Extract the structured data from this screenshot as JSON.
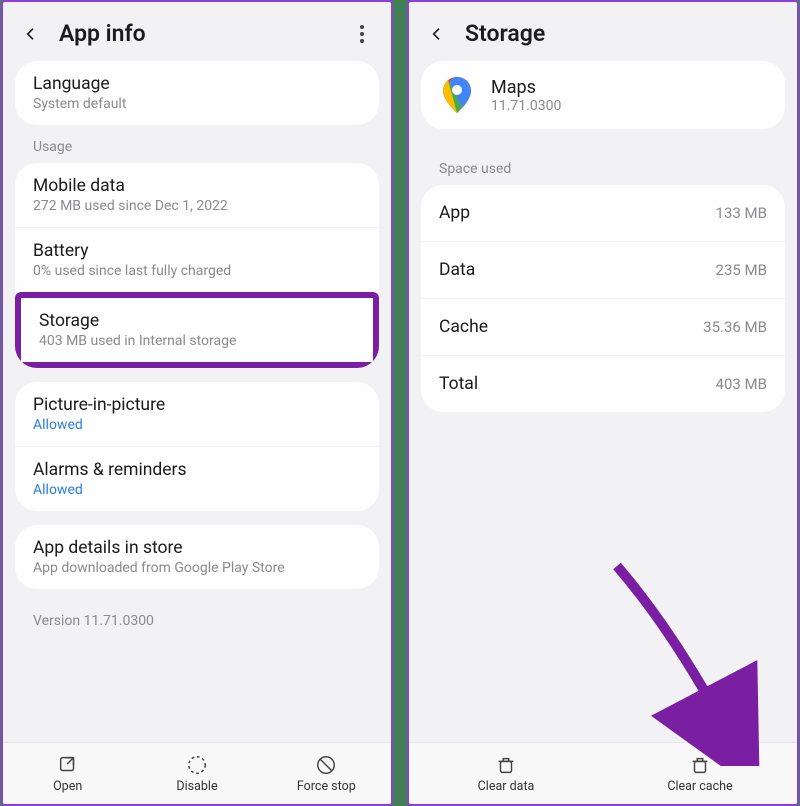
{
  "left": {
    "title": "App info",
    "language": {
      "label": "Language",
      "sub": "System default"
    },
    "section_usage": "Usage",
    "mobile_data": {
      "label": "Mobile data",
      "sub": "272 MB used since Dec 1, 2022"
    },
    "battery": {
      "label": "Battery",
      "sub": "0% used since last fully charged"
    },
    "storage": {
      "label": "Storage",
      "sub": "403 MB used in Internal storage"
    },
    "pip": {
      "label": "Picture-in-picture",
      "sub": "Allowed"
    },
    "alarms": {
      "label": "Alarms & reminders",
      "sub": "Allowed"
    },
    "details": {
      "label": "App details in store",
      "sub": "App downloaded from Google Play Store"
    },
    "version": "Version 11.71.0300",
    "btn_open": "Open",
    "btn_disable": "Disable",
    "btn_force": "Force stop"
  },
  "right": {
    "title": "Storage",
    "app_name": "Maps",
    "app_version": "11.71.0300",
    "section_space": "Space used",
    "rows": {
      "app": {
        "k": "App",
        "v": "133 MB"
      },
      "data": {
        "k": "Data",
        "v": "235 MB"
      },
      "cache": {
        "k": "Cache",
        "v": "35.36 MB"
      },
      "total": {
        "k": "Total",
        "v": "403 MB"
      }
    },
    "btn_clear_data": "Clear data",
    "btn_clear_cache": "Clear cache"
  }
}
